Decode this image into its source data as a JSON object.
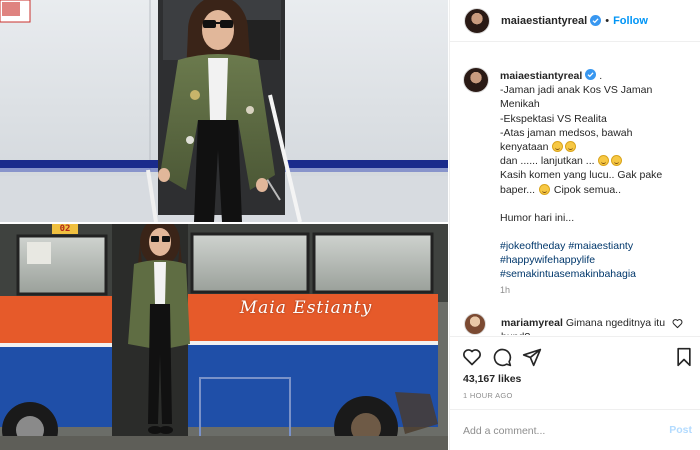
{
  "header": {
    "username": "maiaestiantyreal",
    "separator": "•",
    "follow_label": "Follow"
  },
  "caption": {
    "username": "maiaestiantyreal",
    "lines": [
      " .",
      "-Jaman jadi anak Kos VS Jaman",
      "Menikah",
      "-Ekspektasi VS Realita",
      "-Atas jaman medsos, bawah",
      "kenyataan",
      "dan ...... lanjutkan ...",
      "Kasih komen yang lucu.. Gak pake",
      "baper...",
      "Cipok semua..",
      "Humor hari ini..."
    ],
    "hashtags": [
      "#jokeoftheday",
      "#maiaestianty",
      "#happywifehappylife",
      "#semakintuasemakinbahagia"
    ]
  },
  "time_ago": "1h",
  "comment": {
    "username": "mariamyreal",
    "text": "Gimana ngeditnya itu bund?"
  },
  "post": {
    "likes": "43,167 likes",
    "posted": "1 HOUR AGO"
  },
  "add_comment": {
    "placeholder": "Add a comment...",
    "post_label": "Post"
  },
  "image": {
    "bus_sign_text": "Maia Estianty",
    "route_number": "02"
  },
  "icons": {
    "heart": "heart-icon",
    "comment": "comment-icon",
    "share": "share-icon",
    "bookmark": "bookmark-icon",
    "verified": "verified-badge-icon"
  },
  "colors": {
    "accent": "#0095f6",
    "hashtag": "#00376b",
    "muted": "#8e8e8e",
    "bus_orange": "#e65a2a",
    "bus_blue": "#1f4fa8",
    "plane_stripe": "#1a2b8c"
  }
}
